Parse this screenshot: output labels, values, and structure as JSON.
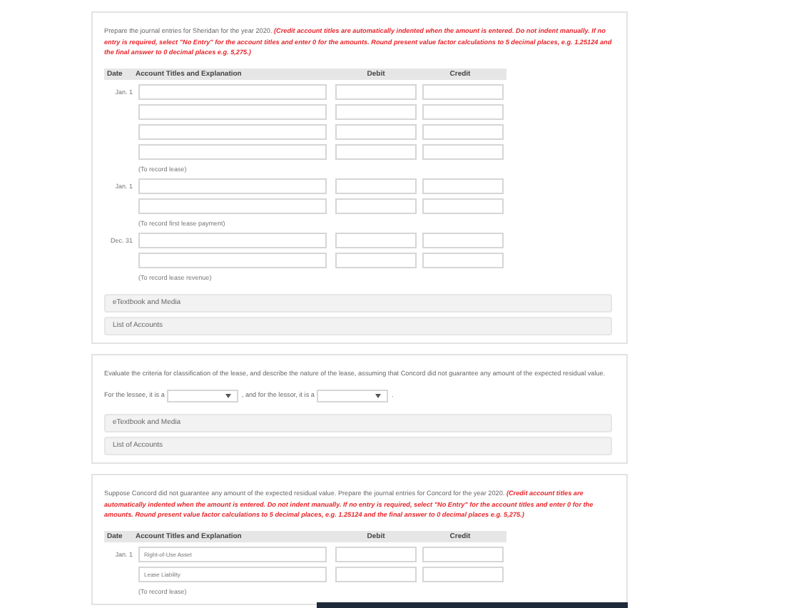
{
  "sections": [
    {
      "kind": "journal",
      "intro": "Prepare the journal entries for Sheridan for the year 2020.",
      "note": "(Credit account titles are automatically indented when the amount is entered. Do not indent manually. If no entry is required, select \"No Entry\" for the account titles and enter 0 for the amounts. Round present value factor calculations to 5 decimal places, e.g. 1.25124 and the final answer to 0 decimal places e.g. 5,275.)",
      "columns": [
        "Date",
        "Account Titles and Explanation",
        "Debit",
        "Credit"
      ],
      "entries": [
        {
          "date": "Jan. 1",
          "lines": [
            {
              "kind": "empty"
            },
            {
              "kind": "empty"
            },
            {
              "kind": "empty"
            },
            {
              "kind": "empty"
            }
          ],
          "memo": "(To record lease)"
        },
        {
          "date": "Jan. 1",
          "lines": [
            {
              "kind": "empty"
            },
            {
              "kind": "empty"
            }
          ],
          "memo": "(To record first lease payment)"
        },
        {
          "date": "Dec. 31",
          "lines": [
            {
              "kind": "empty"
            },
            {
              "kind": "empty"
            }
          ],
          "memo": "(To record lease revenue)"
        }
      ],
      "links": [
        "eTextbook and Media",
        "List of Accounts"
      ]
    },
    {
      "kind": "classify",
      "intro": "Evaluate the criteria for classification of the lease, and describe the nature of the lease, assuming that Concord did not guarantee any amount of the expected residual value.",
      "sentence": [
        "For the lessee, it is a",
        ", and for the lessor, it is a",
        "."
      ],
      "links": [
        "eTextbook and Media",
        "List of Accounts"
      ]
    },
    {
      "kind": "journal",
      "intro": "Suppose Concord did not guarantee any amount of the expected residual value. Prepare the journal entries for Concord for the year 2020.",
      "note": "(Credit account titles are automatically indented when the amount is entered. Do not indent manually. If no entry is required, select \"No Entry\" for the account titles and enter 0 for the amounts. Round present value factor calculations to 5 decimal places, e.g. 1.25124 and the final answer to 0 decimal places e.g. 5,275.)",
      "columns": [
        "Date",
        "Account Titles and Explanation",
        "Debit",
        "Credit"
      ],
      "entries": [
        {
          "date": "Jan. 1",
          "lines": [
            {
              "kind": "filled",
              "account": "Right-of-Use Asset"
            },
            {
              "kind": "filled",
              "account": "Lease Liability"
            }
          ],
          "memo": "(To record lease)"
        }
      ]
    }
  ]
}
